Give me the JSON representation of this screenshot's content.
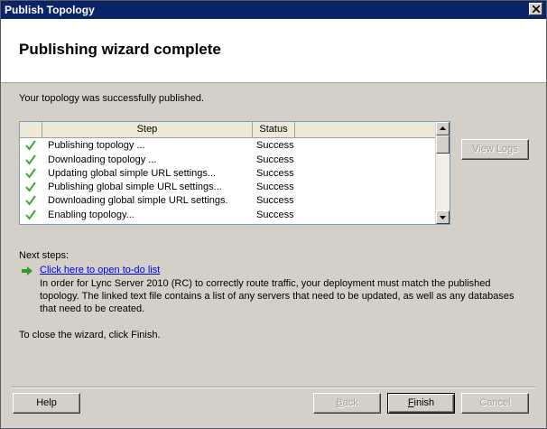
{
  "window": {
    "title": "Publish Topology"
  },
  "header": {
    "title": "Publishing wizard complete"
  },
  "intro": "Your topology was successfully published.",
  "table": {
    "columns": [
      "Step",
      "Status"
    ],
    "rows": [
      {
        "step": "Publishing topology ...",
        "status": "Success"
      },
      {
        "step": "Downloading topology ...",
        "status": "Success"
      },
      {
        "step": "Updating global simple URL settings...",
        "status": "Success"
      },
      {
        "step": "Publishing global simple URL settings...",
        "status": "Success"
      },
      {
        "step": "Downloading global simple URL settings.",
        "status": "Success"
      },
      {
        "step": "Enabling topology...",
        "status": "Success"
      }
    ]
  },
  "view_logs_label": "View Logs",
  "next_steps": {
    "label": "Next steps:",
    "link": "Click here to open to-do list",
    "description_lines": [
      "In order for Lync Server 2010 (RC) to correctly route traffic, your deployment must match the published",
      "topology. The linked text file contains a list of any servers that need to be updated, as well as any databases",
      "that need to be created."
    ]
  },
  "close_hint": "To close the wizard, click Finish.",
  "buttons": {
    "help": "Help",
    "back_rest": "ack",
    "back_ul": "B",
    "finish_ul": "F",
    "finish_rest": "inish",
    "cancel": "Cancel"
  },
  "colors": {
    "titlebar": "#0a246a",
    "check": "#3aa83a",
    "link": "#0000ee"
  },
  "icons": {
    "close": "close-icon",
    "check": "check-icon",
    "arrow": "arrow-right-icon"
  }
}
